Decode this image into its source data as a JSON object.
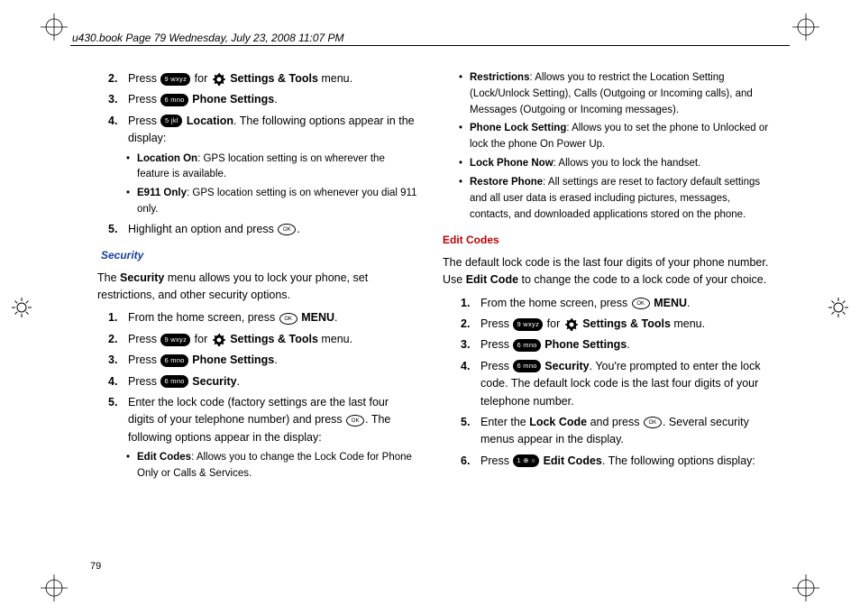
{
  "header": "u430.book  Page 79  Wednesday, July 23, 2008  11:07 PM",
  "pageNumber": "79",
  "keys": {
    "k9": "9 wxyz",
    "k6": "6 mno",
    "k5": "5 jkl",
    "k1": "1 ⊕ ○",
    "ok": "OK"
  },
  "left": {
    "li2a": "Press ",
    "li2b": " for ",
    "li2c": " menu.",
    "settingsTools": "Settings & Tools",
    "li3a": "Press ",
    "phoneSettings": "Phone Settings",
    "li4a": "Press ",
    "location": "Location",
    "li4b": ". The following options appear in the display:",
    "bulletLocOn": "Location On",
    "bulletLocOnTxt": ": GPS location setting is on wherever the feature is available.",
    "bulletE911": "E911 Only",
    "bulletE911Txt": ": GPS location setting is on whenever you dial 911 only.",
    "li5": "Highlight an option and press ",
    "securityHead": "Security",
    "securityPara1a": "The ",
    "securityPara1b": "Security",
    "securityPara1c": " menu allows you to lock your phone, set restrictions, and other security options.",
    "s1": "From the home screen, press ",
    "menu": "MENU",
    "sSecurity": "Security",
    "s5a": "Enter the lock code (factory settings are the last four digits of your telephone number) and press ",
    "s5b": ". The following options appear in the display:",
    "editCodesB": "Edit Codes",
    "editCodesTxt": ": Allows you to change the Lock Code for Phone Only or Calls & Services."
  },
  "right": {
    "restr": "Restrictions",
    "restrTxt": ": Allows you to restrict the Location Setting (Lock/Unlock Setting), Calls (Outgoing or Incoming calls), and Messages (Outgoing or Incoming messages).",
    "pls": "Phone Lock Setting",
    "plsTxt": ": Allows you to set the phone to Unlocked or lock the phone On Power Up.",
    "lpn": "Lock Phone Now",
    "lpnTxt": ": Allows you to lock the handset.",
    "rp": "Restore Phone",
    "rpTxt": ": All settings are reset to factory default settings and all user data is erased including pictures, messages, contacts, and downloaded applications stored on the phone.",
    "editCodesHead": "Edit Codes",
    "ecPara1": "The default lock code is the last four digits of your phone number. Use ",
    "ecPara1b": "Edit Code",
    "ecPara1c": " to change the code to a lock code of your choice.",
    "e4b": ". You're prompted to enter the lock code. The default lock code is the last four digits of your telephone number.",
    "e5a": "Enter the ",
    "e5b": "Lock Code",
    "e5c": " and press ",
    "e5d": ". Several security menus appear in the display.",
    "e6a": "Press ",
    "e6b": "Edit Codes",
    "e6c": ". The following options display:"
  }
}
